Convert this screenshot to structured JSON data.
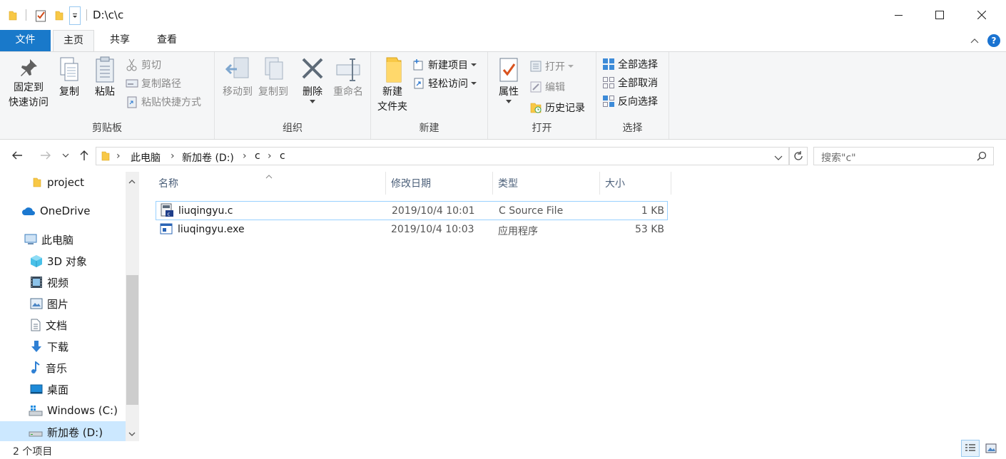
{
  "window": {
    "title": "D:\\c\\c"
  },
  "tabs": {
    "file": "文件",
    "home": "主页",
    "share": "共享",
    "view": "查看"
  },
  "ribbon": {
    "clipboard": {
      "label": "剪贴板",
      "pin_line1": "固定到",
      "pin_line2": "快速访问",
      "copy": "复制",
      "paste": "粘贴",
      "cut": "剪切",
      "copy_path": "复制路径",
      "paste_shortcut": "粘贴快捷方式"
    },
    "organize": {
      "label": "组织",
      "move_to": "移动到",
      "copy_to": "复制到",
      "delete": "删除",
      "rename": "重命名"
    },
    "new": {
      "label": "新建",
      "new_folder_line1": "新建",
      "new_folder_line2": "文件夹",
      "new_item": "新建项目",
      "easy_access": "轻松访问"
    },
    "open": {
      "label": "打开",
      "properties": "属性",
      "open": "打开",
      "edit": "编辑",
      "history": "历史记录"
    },
    "select": {
      "label": "选择",
      "select_all": "全部选择",
      "select_none": "全部取消",
      "invert": "反向选择"
    }
  },
  "address": {
    "crumbs": [
      "此电脑",
      "新加卷 (D:)",
      "c",
      "c"
    ]
  },
  "search": {
    "placeholder": "搜索\"c\""
  },
  "nav": {
    "items": [
      "project",
      "OneDrive",
      "此电脑",
      "3D 对象",
      "视频",
      "图片",
      "文档",
      "下载",
      "音乐",
      "桌面",
      "Windows (C:)",
      "新加卷 (D:)"
    ]
  },
  "columns": {
    "name": "名称",
    "modified": "修改日期",
    "type": "类型",
    "size": "大小"
  },
  "files": [
    {
      "name": "liuqingyu.c",
      "modified": "2019/10/4 10:01",
      "type": "C Source File",
      "size": "1 KB"
    },
    {
      "name": "liuqingyu.exe",
      "modified": "2019/10/4 10:03",
      "type": "应用程序",
      "size": "53 KB"
    }
  ],
  "status": {
    "count": "2 个项目"
  },
  "colors": {
    "accent": "#1979ca",
    "folder": "#f8c846",
    "selection": "#cce8ff"
  }
}
